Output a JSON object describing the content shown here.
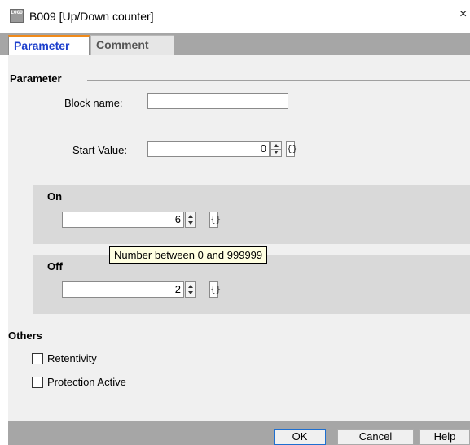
{
  "window": {
    "title": "B009 [Up/Down counter]",
    "close_glyph": "×",
    "icon_text": "LOGO"
  },
  "tabs": [
    {
      "label": "Parameter",
      "active": true
    },
    {
      "label": "Comment",
      "active": false
    }
  ],
  "parameter_group": {
    "label": "Parameter",
    "block_name_label": "Block name:",
    "block_name_value": "",
    "start_value_label": "Start Value:",
    "start_value": "0"
  },
  "on_group": {
    "label": "On",
    "value": "6"
  },
  "off_group": {
    "label": "Off",
    "value": "2"
  },
  "tooltip": {
    "text": "Number between 0 and 999999"
  },
  "others_group": {
    "label": "Others",
    "checkboxes": [
      {
        "label": "Retentivity",
        "checked": false
      },
      {
        "label": "Protection Active",
        "checked": false
      }
    ]
  },
  "buttons": {
    "ok": "OK",
    "cancel": "Cancel",
    "help": "Help"
  },
  "icons": {
    "spin": "spin-updown-icon",
    "param_ref": "parameter-reference-icon",
    "bracket_glyph": "{}"
  },
  "colors": {
    "active_tab_text": "#1d3fcc",
    "active_tab_accent": "#f08a1a",
    "ok_border": "#1e6fd0",
    "tooltip_bg": "#ffffe1"
  }
}
